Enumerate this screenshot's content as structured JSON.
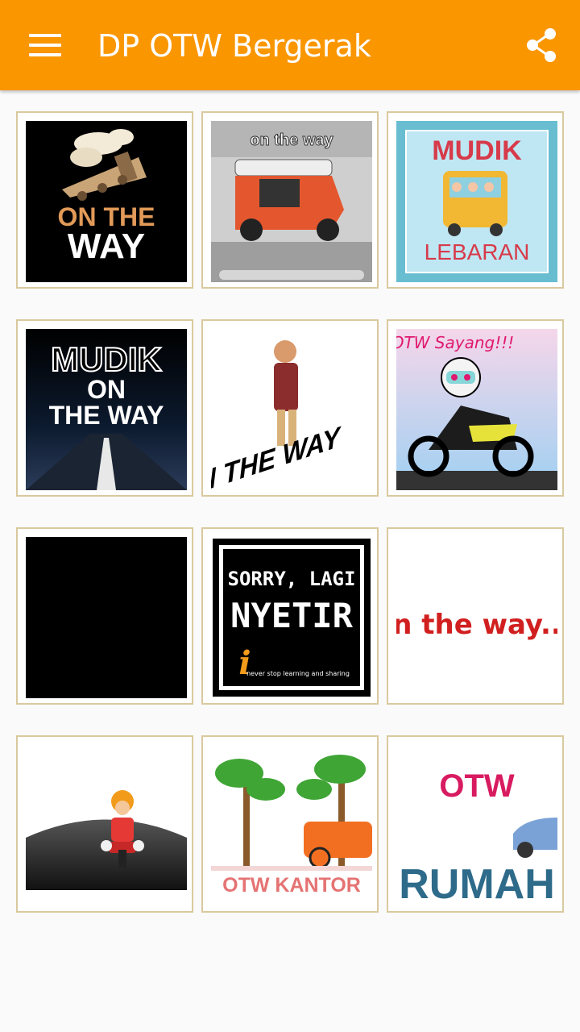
{
  "app_title": "DP OTW Bergerak",
  "icons": {
    "menu": "hamburger-menu-icon",
    "share": "share-icon"
  },
  "colors": {
    "appbar": "#fa9600",
    "tile_border": "#d9c99e",
    "background": "#fafafa"
  },
  "tiles": [
    {
      "name": "train",
      "lines": [
        "ON THE",
        "WAY"
      ]
    },
    {
      "name": "bajaj",
      "lines": [
        "on the way"
      ]
    },
    {
      "name": "mudik-lebaran",
      "lines": [
        "MUDIK",
        "LEBARAN"
      ]
    },
    {
      "name": "mudik-road",
      "lines": [
        "MUDIK",
        "ON",
        "THE WAY"
      ]
    },
    {
      "name": "walking-man",
      "lines": [
        "ON THE WAY"
      ]
    },
    {
      "name": "otw-sayang",
      "lines": [
        "OTW Sayang!!!"
      ]
    },
    {
      "name": "black",
      "lines": []
    },
    {
      "name": "sorry-nyetir",
      "lines": [
        "SORRY, LAGI",
        "NYETIR",
        "never stop learning and sharing"
      ]
    },
    {
      "name": "on-the-way-text",
      "lines": [
        "n the way.."
      ]
    },
    {
      "name": "motor-road",
      "lines": []
    },
    {
      "name": "otw-kantor",
      "lines": [
        "OTW KANTOR"
      ]
    },
    {
      "name": "otw-rumah",
      "lines": [
        "OTW",
        "RUMAH"
      ]
    }
  ]
}
